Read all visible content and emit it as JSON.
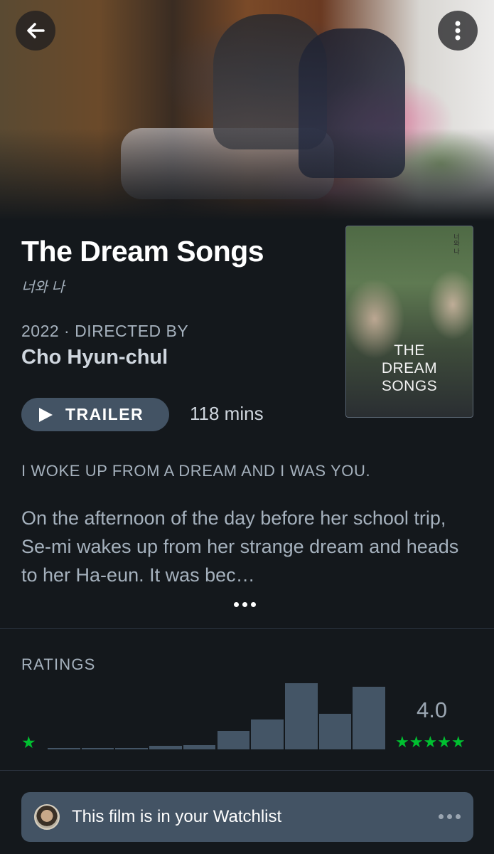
{
  "header": {
    "back_icon": "arrow-left-icon",
    "more_icon": "vertical-dots-icon"
  },
  "film": {
    "title": "The Dream Songs",
    "original_title": "너와 나",
    "year_director_line": "2022 · DIRECTED BY",
    "director": "Cho Hyun-chul",
    "trailer_label": "TRAILER",
    "runtime": "118 mins",
    "poster_title": "THE\nDREAM\nSONGS",
    "poster_korean": "너와 나",
    "tagline": "I WOKE UP FROM A DREAM AND I WAS YOU.",
    "synopsis": "On the afternoon of the day before her school trip, Se-mi wakes up from her strange dream and heads to her Ha-eun. It was bec…"
  },
  "ratings": {
    "label": "RATINGS",
    "average": "4.0",
    "low_star": "★",
    "high_stars": "★★★★★",
    "star_color": "#00c030",
    "histogram_max": 1.0,
    "histogram": [
      0.01,
      0.02,
      0.02,
      0.05,
      0.06,
      0.28,
      0.45,
      1.0,
      0.54,
      0.95
    ]
  },
  "watchlist": {
    "text": "This film is in your Watchlist",
    "more_icon": "horizontal-dots-icon"
  },
  "colors": {
    "background": "#14181c",
    "accent_green": "#00c030",
    "button_slate": "#435364",
    "bar": "#445566"
  }
}
